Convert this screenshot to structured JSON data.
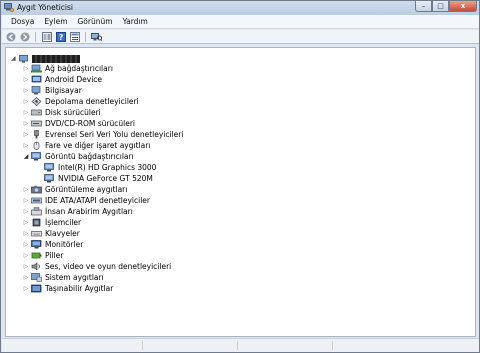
{
  "window": {
    "title": "Aygıt Yöneticisi",
    "controls": {
      "minimize": "–",
      "maximize": "□",
      "close": "x"
    }
  },
  "menu": [
    "Dosya",
    "Eylem",
    "Görünüm",
    "Yardım"
  ],
  "toolbar": [
    "back-icon",
    "forward-icon",
    "tree-view-icon",
    "help-icon",
    "properties-icon",
    "scan-hardware-icon"
  ],
  "tree": {
    "root_name_redacted": true,
    "categories": [
      {
        "label": "Ağ bağdaştırıcıları",
        "icon": "network-adapter-icon",
        "expanded": false
      },
      {
        "label": "Android Device",
        "icon": "android-device-icon",
        "expanded": false
      },
      {
        "label": "Bilgisayar",
        "icon": "computer-icon",
        "expanded": false
      },
      {
        "label": "Depolama denetleyicileri",
        "icon": "storage-controller-icon",
        "expanded": false
      },
      {
        "label": "Disk sürücüleri",
        "icon": "disk-drive-icon",
        "expanded": false
      },
      {
        "label": "DVD/CD-ROM sürücüleri",
        "icon": "dvd-drive-icon",
        "expanded": false
      },
      {
        "label": "Evrensel Seri Veri Yolu denetleyicileri",
        "icon": "usb-controller-icon",
        "expanded": false
      },
      {
        "label": "Fare ve diğer işaret aygıtları",
        "icon": "mouse-icon",
        "expanded": false
      },
      {
        "label": "Görüntü bağdaştırıcıları",
        "icon": "display-adapter-icon",
        "expanded": true,
        "children": [
          "Intel(R) HD Graphics 3000",
          "NVIDIA GeForce GT 520M"
        ]
      },
      {
        "label": "Görüntüleme aygıtları",
        "icon": "imaging-device-icon",
        "expanded": false
      },
      {
        "label": "IDE ATA/ATAPI denetleyiciler",
        "icon": "ide-controller-icon",
        "expanded": false
      },
      {
        "label": "İnsan Arabirim Aygıtları",
        "icon": "hid-icon",
        "expanded": false
      },
      {
        "label": "İşlemciler",
        "icon": "processor-icon",
        "expanded": false
      },
      {
        "label": "Klavyeler",
        "icon": "keyboard-icon",
        "expanded": false
      },
      {
        "label": "Monitörler",
        "icon": "monitor-icon",
        "expanded": false
      },
      {
        "label": "Piller",
        "icon": "battery-icon",
        "expanded": false
      },
      {
        "label": "Ses, video ve oyun denetleyicileri",
        "icon": "sound-icon",
        "expanded": false
      },
      {
        "label": "Sistem aygıtları",
        "icon": "system-device-icon",
        "expanded": false
      },
      {
        "label": "Taşınabilir Aygıtlar",
        "icon": "portable-device-icon",
        "expanded": false
      }
    ]
  },
  "colors": {
    "titlebar": "#c6d5e8",
    "close_button": "#c74a32",
    "window_frame": "#dfe6ef",
    "tree_background": "#ffffff"
  }
}
